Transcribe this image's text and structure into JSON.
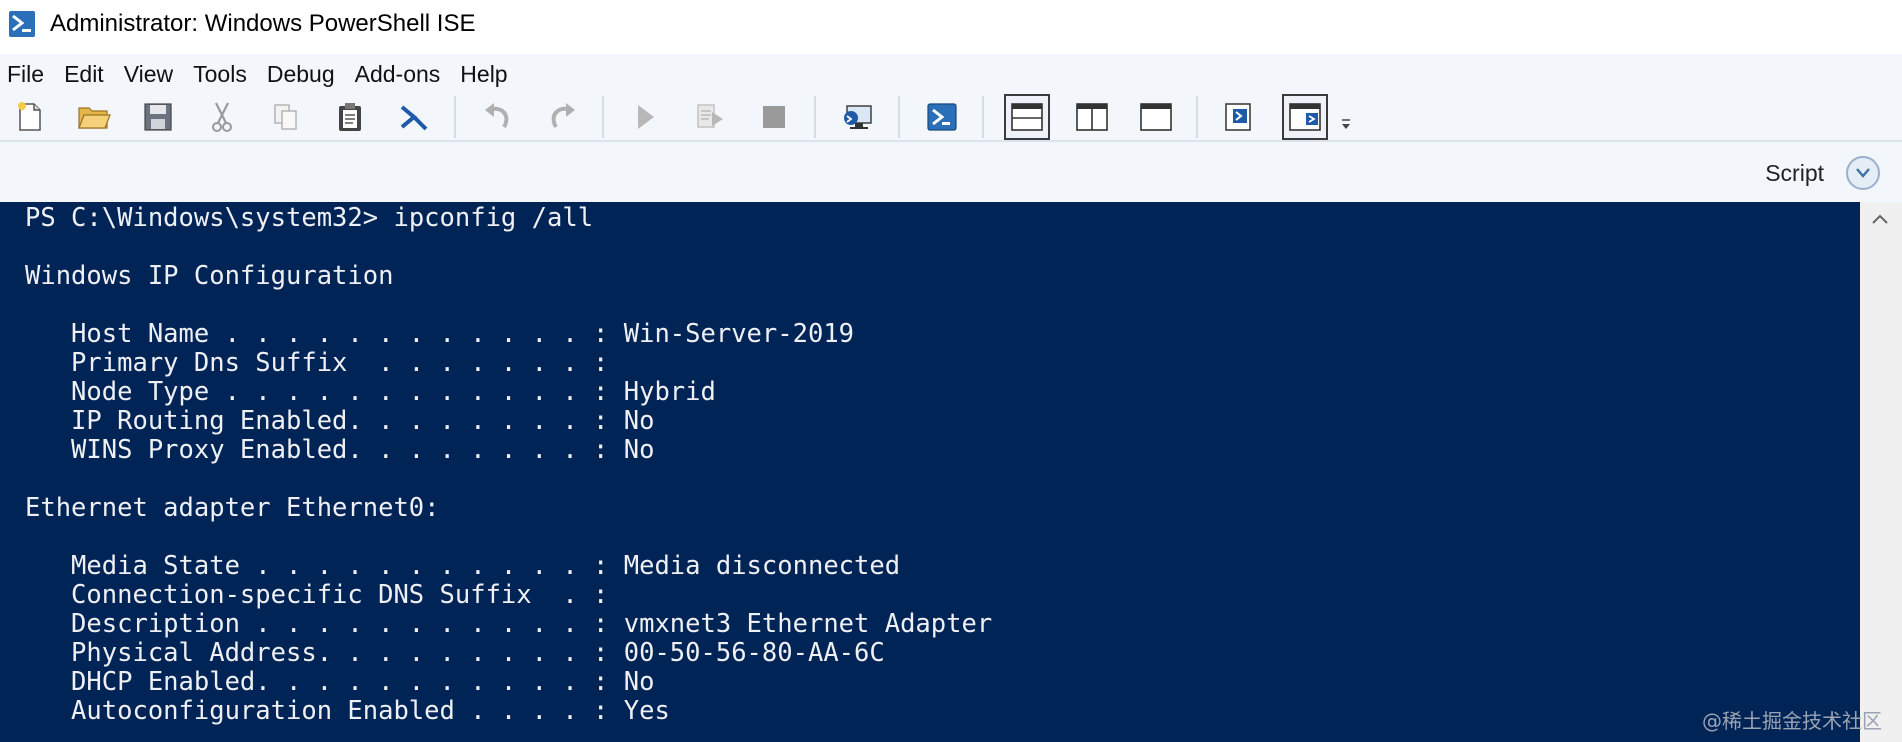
{
  "window": {
    "title": "Administrator: Windows PowerShell ISE"
  },
  "menu": [
    "File",
    "Edit",
    "View",
    "Tools",
    "Debug",
    "Add-ons",
    "Help"
  ],
  "toolbar": {
    "icons": [
      "new-file-icon",
      "open-folder-icon",
      "save-icon",
      "cut-icon",
      "copy-icon",
      "paste-icon",
      "clear-console-icon",
      "undo-icon",
      "redo-icon",
      "run-script-icon",
      "run-selection-icon",
      "stop-icon",
      "remote-powershell-icon",
      "powershell-console-icon",
      "layout-top-icon",
      "layout-right-icon",
      "layout-max-icon",
      "show-script-pane-icon",
      "show-command-addon-icon"
    ]
  },
  "script_pane": {
    "label": "Script"
  },
  "console": {
    "prompt": "PS C:\\Windows\\system32> ",
    "command": "ipconfig /all",
    "lines": [
      "",
      "Windows IP Configuration",
      "",
      "   Host Name . . . . . . . . . . . . : Win-Server-2019",
      "   Primary Dns Suffix  . . . . . . . :",
      "   Node Type . . . . . . . . . . . . : Hybrid",
      "   IP Routing Enabled. . . . . . . . : No",
      "   WINS Proxy Enabled. . . . . . . . : No",
      "",
      "Ethernet adapter Ethernet0:",
      "",
      "   Media State . . . . . . . . . . . : Media disconnected",
      "   Connection-specific DNS Suffix  . :",
      "   Description . . . . . . . . . . . : vmxnet3 Ethernet Adapter",
      "   Physical Address. . . . . . . . . : 00-50-56-80-AA-6C",
      "   DHCP Enabled. . . . . . . . . . . : No",
      "   Autoconfiguration Enabled . . . . : Yes"
    ]
  },
  "watermark": "@稀土掘金技术社区",
  "colors": {
    "console_bg": "#012456",
    "console_fg": "#eef0f4",
    "chrome_bg": "#f3f6fb"
  }
}
